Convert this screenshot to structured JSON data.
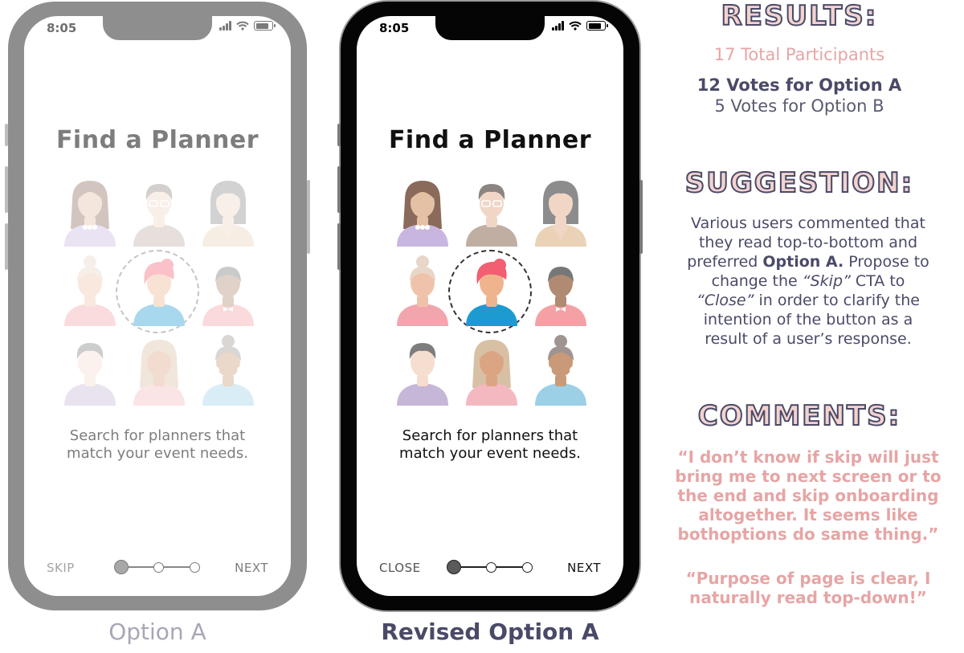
{
  "colors": {
    "pink": "#e6a5a5",
    "navy": "#4a4a68",
    "heading_fill": "#f3d3cf",
    "faded_gray": "#8a8a8a"
  },
  "option_a": {
    "status_time": "8:05",
    "title": "Find a Planner",
    "subtitle_line1": "Search for planners that",
    "subtitle_line2": "match your event needs.",
    "left_action": "SKIP",
    "right_action": "NEXT",
    "label": "Option A",
    "current_step": 1,
    "total_steps": 3
  },
  "option_b": {
    "status_time": "8:05",
    "title": "Find a Planner",
    "subtitle_line1": "Search for planners that",
    "subtitle_line2": "match your event needs.",
    "left_action": "CLOSE",
    "right_action": "NEXT",
    "label": "Revised Option A",
    "current_step": 1,
    "total_steps": 3
  },
  "results": {
    "heading": "RESULTS:",
    "total": "17 Total Participants",
    "votes_a": "12 Votes for Option A",
    "votes_b": "5 Votes for Option B"
  },
  "suggestion": {
    "heading": "SUGGESTION:",
    "line1": "Various users commented that",
    "line2": "they read top-to-bottom and",
    "line3_pre": "preferred ",
    "line3_bold": "Option A.",
    "line3_post": " Propose to",
    "line4_pre": "change the ",
    "line4_italic": "“Skip”",
    "line4_post": " CTA to",
    "line5_italic": "“Close”",
    "line5_post": " in order to clarify the",
    "line6": "intention of the button as a",
    "line7": "result of a user’s response."
  },
  "comments": {
    "heading": "COMMENTS:",
    "quote1_line1": "“I don’t know if skip will just",
    "quote1_line2": "bring me to next screen or to",
    "quote1_line3": "the end and skip onboarding",
    "quote1_line4": "altogether. It seems like",
    "quote1_line5": "bothoptions do same thing.”",
    "quote2_line1": "“Purpose of page is clear, I",
    "quote2_line2": "naturally read top-down!”"
  }
}
